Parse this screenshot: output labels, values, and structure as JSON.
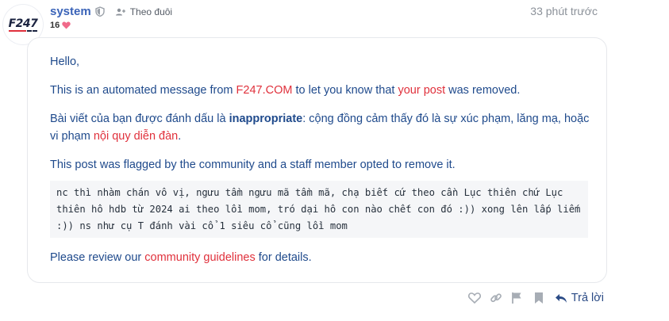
{
  "post": {
    "avatar_logo": "F247",
    "username": "system",
    "follow_label": "Theo đuôi",
    "time": "33 phút trước",
    "likes_count": "16"
  },
  "message": {
    "greeting": "Hello,",
    "p1_a": "This is an automated message from ",
    "p1_site": "F247.COM",
    "p1_b": " to let you know that ",
    "p1_link": "your post",
    "p1_c": " was removed.",
    "p2_a": "Bài viết của bạn được đánh dấu là ",
    "p2_flag": "inappropriate",
    "p2_b": ": cộng đồng cảm thấy đó là sự xúc phạm, lăng mạ, hoặc vi phạm ",
    "p2_link": "nội quy diễn đàn",
    "p2_c": ".",
    "p3": "This post was flagged by the community and a staff member opted to remove it.",
    "quote": "nc thì nhàm chán vô vị, ngưu tầm ngưu mã tầm mã, chạ biết cứ theo cần Lục thiên chứ Lục thiên hô hdb từ 2024 ai theo lồi mom, tró dại hô con nào chết con đó :)) xong lên lấp liếm :)) ns như cụ T đánh vài cổ 1 siêu cổ cũng lồi mom",
    "p4_a": "Please review our ",
    "p4_link": "community guidelines",
    "p4_b": " for details."
  },
  "actions": {
    "reply_label": "Trả lời"
  },
  "colors": {
    "link_red": "#e0313c",
    "text_blue": "#1f4a8c",
    "username_blue": "#3a63b8",
    "heart_pink": "#f06a8a"
  }
}
